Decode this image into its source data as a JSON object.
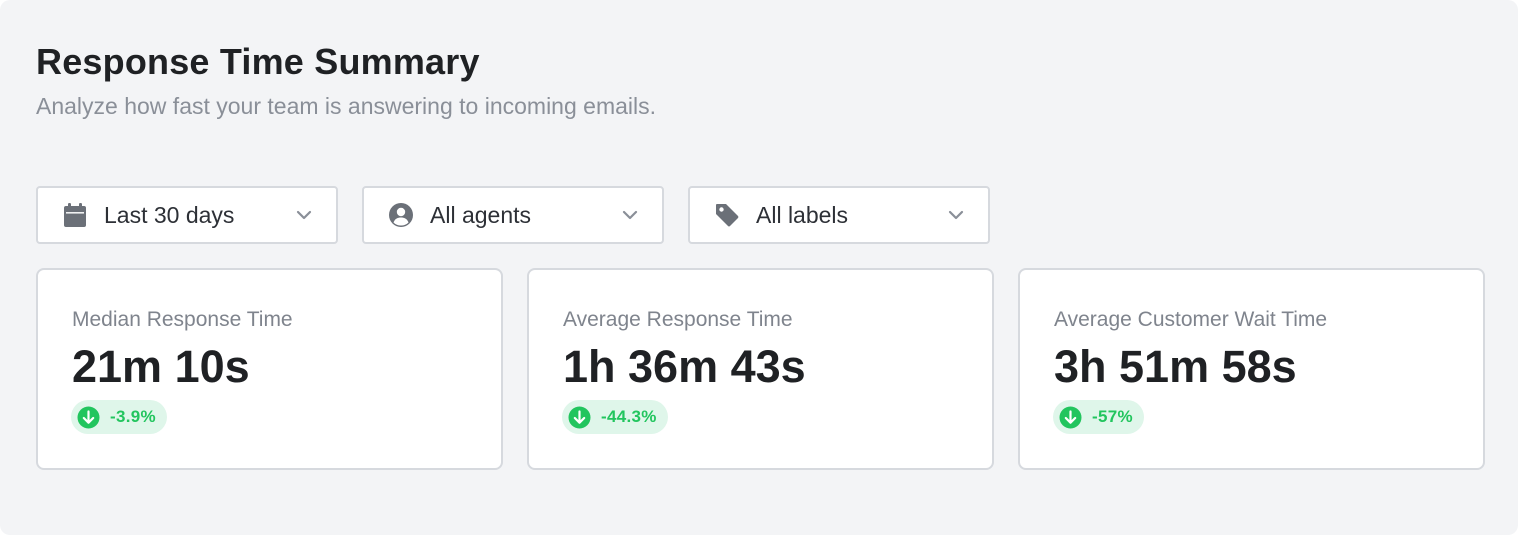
{
  "header": {
    "title": "Response Time Summary",
    "subtitle": "Analyze how fast your team is answering to incoming emails."
  },
  "filters": [
    {
      "label": "Last 30 days",
      "icon": "calendar-icon"
    },
    {
      "label": "All agents",
      "icon": "user-circle-icon"
    },
    {
      "label": "All labels",
      "icon": "tag-icon"
    }
  ],
  "metrics": [
    {
      "label": "Median Response Time",
      "value": "21m 10s",
      "change": "-3.9%",
      "trend_icon": "arrow-down-circle-icon"
    },
    {
      "label": "Average Response Time",
      "value": "1h 36m 43s",
      "change": "-44.3%",
      "trend_icon": "arrow-down-circle-icon"
    },
    {
      "label": "Average Customer Wait Time",
      "value": "3h 51m 58s",
      "change": "-57%",
      "trend_icon": "arrow-down-circle-icon"
    }
  ],
  "colors": {
    "background": "#f3f4f6",
    "card": "#ffffff",
    "border": "#d6d9de",
    "text_primary": "#1f2124",
    "text_secondary": "#8a8f98",
    "icon": "#6b7078",
    "positive": "#22c55e",
    "positive_bg": "#dff6ea"
  }
}
